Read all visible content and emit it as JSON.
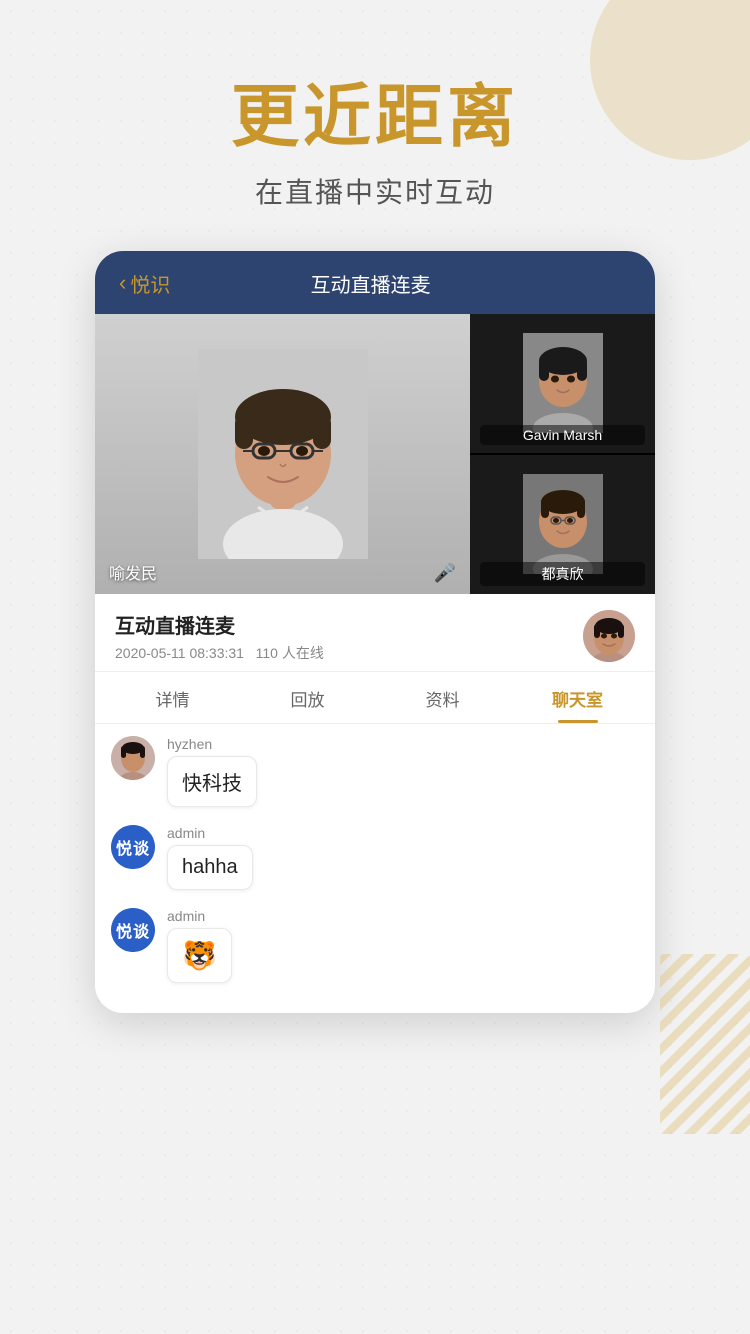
{
  "background": {
    "dots": true
  },
  "hero": {
    "title": "更近距离",
    "subtitle": "在直播中实时互动"
  },
  "phone": {
    "header": {
      "back_icon": "‹",
      "back_label": "悦识",
      "title": "互动直播连麦"
    },
    "video": {
      "main_person": "喻发民",
      "mic_icon": "🎤",
      "side_persons": [
        {
          "name": "Gavin Marsh"
        },
        {
          "name": "都真欣"
        }
      ]
    },
    "info": {
      "title": "互动直播连麦",
      "date": "2020-05-11 08:33:31",
      "viewers": "110 人在线"
    },
    "tabs": [
      {
        "label": "详情",
        "active": false
      },
      {
        "label": "回放",
        "active": false
      },
      {
        "label": "资料",
        "active": false
      },
      {
        "label": "聊天室",
        "active": true
      }
    ],
    "chat": [
      {
        "user": "hyzhen",
        "avatar_type": "photo",
        "message": "快科技",
        "is_emoji": false
      },
      {
        "user": "admin",
        "avatar_type": "yueshi",
        "message": "hahha",
        "is_emoji": false
      },
      {
        "user": "admin",
        "avatar_type": "yueshi",
        "message": "🐯",
        "is_emoji": true
      }
    ]
  },
  "decoration": {
    "badge_text": "悦谈",
    "badge_text2": "悦谈"
  }
}
